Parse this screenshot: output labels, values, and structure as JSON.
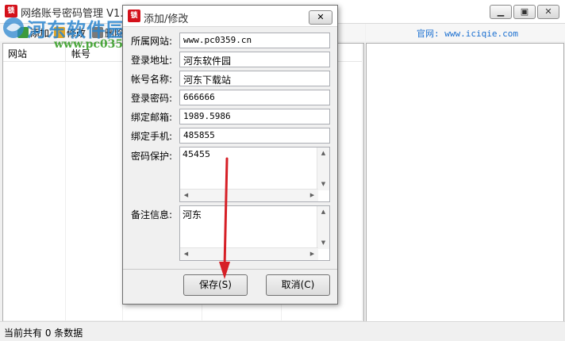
{
  "main_window": {
    "title": "网络账号密码管理 V1.7",
    "icon": "app-red-icon",
    "controls": [
      "minimize-icon",
      "restore-icon",
      "close-icon"
    ]
  },
  "toolbar": {
    "items": [
      {
        "label": "添加",
        "icon": "add-icon"
      },
      {
        "label": "修改",
        "icon": "edit-icon"
      },
      {
        "label": "删除",
        "icon": "delete-icon"
      }
    ]
  },
  "site": {
    "url_label": "官网: www.iciqie.com"
  },
  "table": {
    "columns": [
      "网站",
      "帐号"
    ],
    "rows": []
  },
  "status": {
    "text": "当前共有 0 条数据"
  },
  "watermark": {
    "title": "河东软件园",
    "url": "www.pc0359.cn"
  },
  "dialog": {
    "title": "添加/修改",
    "fields": [
      {
        "label": "所属网站:",
        "value": "www.pc0359.cn"
      },
      {
        "label": "登录地址:",
        "value": "河东软件园"
      },
      {
        "label": "帐号名称:",
        "value": "河东下载站"
      },
      {
        "label": "登录密码:",
        "value": "666666"
      },
      {
        "label": "绑定邮箱:",
        "value": "1989.5986"
      },
      {
        "label": "绑定手机:",
        "value": "485855"
      }
    ],
    "password_protect": {
      "label": "密码保护:",
      "value": "45455"
    },
    "notes": {
      "label": "备注信息:",
      "value": "河东"
    },
    "save_label": "保存(S)",
    "cancel_label": "取消(C)"
  },
  "colors": {
    "arrow": "#d61f26",
    "link": "#1a6fd0",
    "watermark_blue": "#2b86cf",
    "watermark_green": "#3aa02a"
  }
}
